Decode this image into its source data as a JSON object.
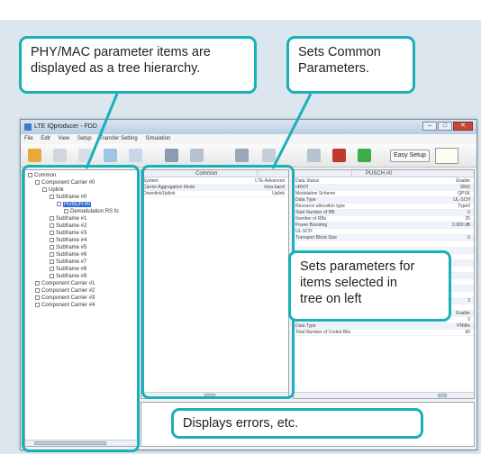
{
  "callouts": {
    "tree": [
      "PHY/MAC parameter items are",
      "displayed as a tree hierarchy."
    ],
    "common": [
      "Sets Common",
      "Parameters."
    ],
    "params": [
      "Sets parameters for",
      "items selected in",
      "tree on left"
    ],
    "errors": "Displays errors, etc."
  },
  "window": {
    "title": "LTE IQproducer - FDD",
    "menu": [
      "File",
      "Edit",
      "View",
      "Setup",
      "Transfer Setting",
      "Simulation"
    ],
    "easy_setup": "Easy Setup"
  },
  "tree": {
    "nodes": [
      {
        "label": "Common",
        "level": 0
      },
      {
        "label": "Component Carrier #0",
        "level": 1
      },
      {
        "label": "Uplink",
        "level": 2
      },
      {
        "label": "Subframe #0",
        "level": 3
      },
      {
        "label": "PUSCH #0",
        "level": 4,
        "selected": true
      },
      {
        "label": "Demodulation RS fo",
        "level": 5
      },
      {
        "label": "Subframe #1",
        "level": 3
      },
      {
        "label": "Subframe #2",
        "level": 3
      },
      {
        "label": "Subframe #3",
        "level": 3
      },
      {
        "label": "Subframe #4",
        "level": 3
      },
      {
        "label": "Subframe #5",
        "level": 3
      },
      {
        "label": "Subframe #6",
        "level": 3
      },
      {
        "label": "Subframe #7",
        "level": 3
      },
      {
        "label": "Subframe #8",
        "level": 3
      },
      {
        "label": "Subframe #9",
        "level": 3
      },
      {
        "label": "Component Carrier #1",
        "level": 1
      },
      {
        "label": "Component Carrier #2",
        "level": 1
      },
      {
        "label": "Component Carrier #3",
        "level": 1
      },
      {
        "label": "Component Carrier #4",
        "level": 1
      }
    ]
  },
  "common_grid": {
    "header": "Common",
    "rows": [
      {
        "k": "System",
        "v": "LTE-Advanced"
      },
      {
        "k": "Carrier Aggregation Mode",
        "v": "Intra-band"
      },
      {
        "k": "Downlink/Uplink",
        "v": "Uplink"
      }
    ]
  },
  "param_grid": {
    "header": "PUSCH #0",
    "rows": [
      {
        "k": "Data Status",
        "v": "Enable"
      },
      {
        "k": "nRNTI",
        "v": "0000"
      },
      {
        "k": "Modulation Scheme",
        "v": "QPSK"
      },
      {
        "k": "Data Type",
        "v": "UL-SCH"
      },
      {
        "k": "Resource allocation type",
        "v": "Type0"
      },
      {
        "k": "Start Number of RB",
        "v": "0"
      },
      {
        "k": "Number of RBs",
        "v": "25"
      },
      {
        "k": "Power Boosting",
        "v": "0.000 dB"
      },
      {
        "k": "UL-SCH",
        "v": ""
      },
      {
        "k": "Transport Block Size",
        "v": "0"
      },
      {
        "k": "",
        "v": ""
      },
      {
        "k": "",
        "v": ""
      },
      {
        "k": "",
        "v": ""
      },
      {
        "k": "",
        "v": ""
      },
      {
        "k": "",
        "v": ""
      },
      {
        "k": "",
        "v": ""
      },
      {
        "k": "",
        "v": ""
      },
      {
        "k": "",
        "v": ""
      },
      {
        "k": "",
        "v": ""
      },
      {
        "k": "Total Number of Coded Bits",
        "v": "2"
      },
      {
        "k": "UCI (PH)",
        "v": ""
      },
      {
        "k": "Data Status",
        "v": "Enable"
      },
      {
        "k": "ACK/NAK",
        "v": "0"
      },
      {
        "k": "Data Type",
        "v": "PN9fix"
      },
      {
        "k": "Total Number of Coded Bits",
        "v": "60"
      }
    ]
  },
  "colors": {
    "callout_border": "#19b0b8",
    "selection": "#2f6fd6"
  }
}
